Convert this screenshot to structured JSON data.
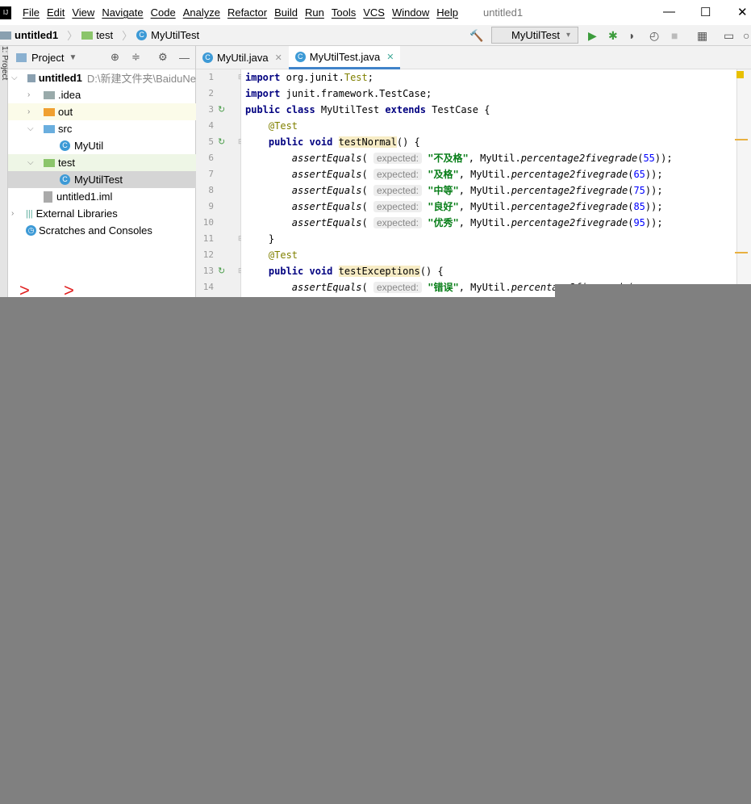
{
  "menubar": {
    "items": [
      "File",
      "Edit",
      "View",
      "Navigate",
      "Code",
      "Analyze",
      "Refactor",
      "Build",
      "Run",
      "Tools",
      "VCS",
      "Window",
      "Help"
    ],
    "window_title": "untitled1"
  },
  "breadcrumb": [
    "untitled1",
    "test",
    "MyUtilTest"
  ],
  "toolbar": {
    "run_config": "MyUtilTest"
  },
  "project": {
    "title": "Project",
    "items": [
      {
        "label": "untitled1",
        "hint": "D:\\新建文件夹\\BaiduNe"
      },
      {
        "label": ".idea"
      },
      {
        "label": "out"
      },
      {
        "label": "src"
      },
      {
        "label": "MyUtil"
      },
      {
        "label": "test"
      },
      {
        "label": "MyUtilTest"
      },
      {
        "label": "untitled1.iml"
      },
      {
        "label": "External Libraries"
      },
      {
        "label": "Scratches and Consoles"
      }
    ],
    "side_label": "1: Project",
    "annotation": "> >"
  },
  "tabs": [
    {
      "label": "MyUtil.java"
    },
    {
      "label": "MyUtilTest.java",
      "active": true
    }
  ],
  "editor": {
    "line_numbers": [
      "1",
      "2",
      "3",
      "4",
      "5",
      "6",
      "7",
      "8",
      "9",
      "10",
      "11",
      "12",
      "13",
      "14"
    ],
    "param_hint": "expected:",
    "cases": [
      {
        "s": "\"不及格\"",
        "n": "55"
      },
      {
        "s": "\"及格\"",
        "n": "65"
      },
      {
        "s": "\"中等\"",
        "n": "75"
      },
      {
        "s": "\"良好\"",
        "n": "85"
      },
      {
        "s": "\"优秀\"",
        "n": "95"
      }
    ],
    "exception_string": "\"错误\""
  },
  "colors": {
    "accent": "#4083c9",
    "overlay": "#808080"
  }
}
